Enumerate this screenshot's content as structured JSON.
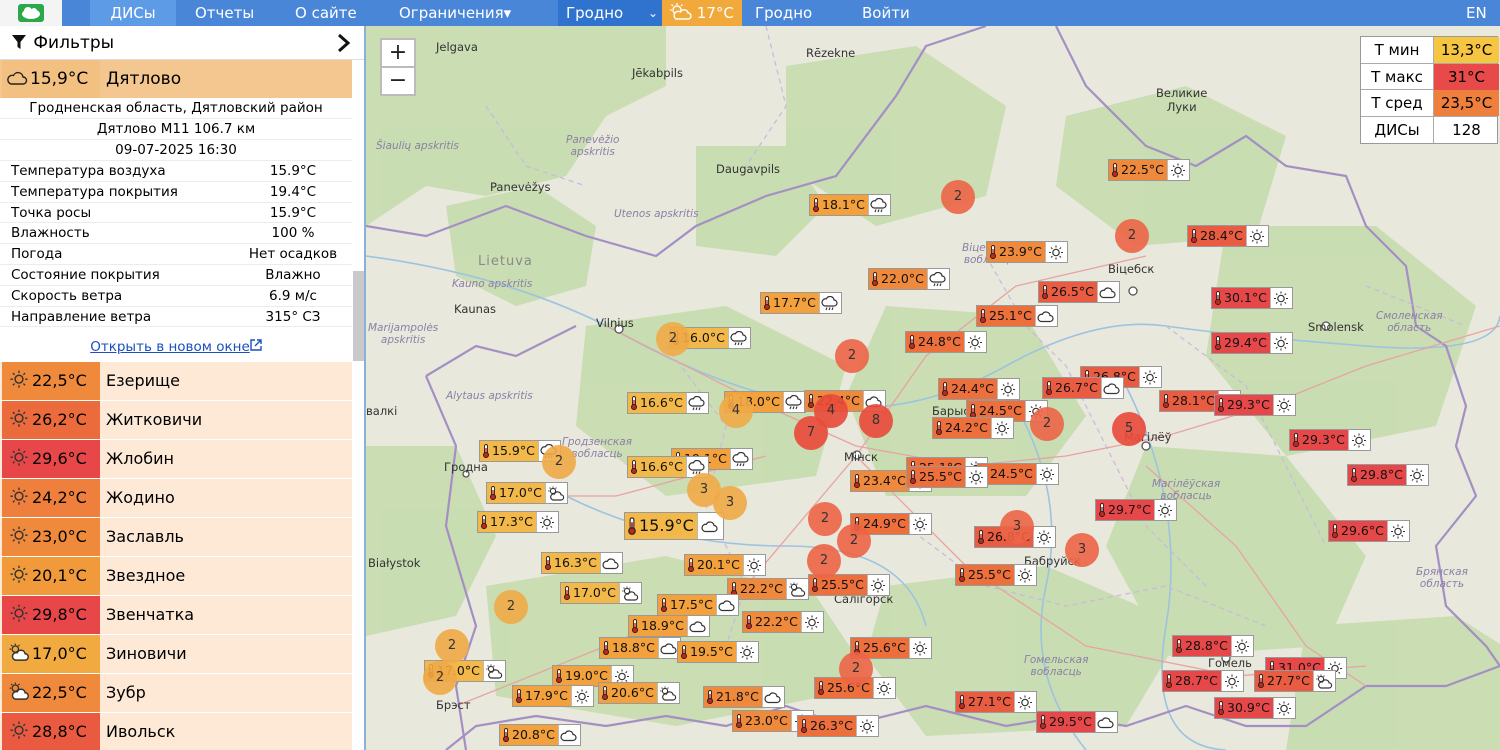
{
  "colors": {
    "topbar": "#4a86d8",
    "orange": "#f0a848",
    "darkorange": "#ee7f3c",
    "red": "#e84a4a",
    "pale": "#fde9d6"
  },
  "nav": {
    "logo": "cloud-logo-icon",
    "dis": "ДИСы",
    "reports": "Отчеты",
    "about": "О сайте",
    "limits": "Ограничения▾",
    "region_select": "Гродно",
    "weather_temp": "17°C",
    "weather_city": "Гродно",
    "login": "Войти",
    "lang": "EN"
  },
  "panel": {
    "filters": "Фильтры",
    "selected": {
      "temp": "15,9°C",
      "name": "Дятлово",
      "region": "Гродненская область, Дятловский район",
      "road": "Дятлово М11 106.7 км",
      "datetime": "09-07-2025 16:30"
    },
    "details": [
      {
        "k": "Температура воздуха",
        "v": "15.9°C"
      },
      {
        "k": "Температура покрытия",
        "v": "19.4°C"
      },
      {
        "k": "Точка росы",
        "v": "15.9°C"
      },
      {
        "k": "Влажность",
        "v": "100 %"
      },
      {
        "k": "Погода",
        "v": "Нет осадков"
      },
      {
        "k": "Состояние покрытия",
        "v": "Влажно"
      },
      {
        "k": "Скорость ветра",
        "v": "6.9 м/с"
      },
      {
        "k": "Направление ветра",
        "v": "315° СЗ"
      }
    ],
    "open_link": "Открыть в новом окне",
    "stations": [
      {
        "temp": "22,5°C",
        "name": "Езерище",
        "icon": "sun",
        "color": "#ef8a3c"
      },
      {
        "temp": "26,2°C",
        "name": "Житковичи",
        "icon": "sun",
        "color": "#ec6b3c"
      },
      {
        "temp": "29,6°C",
        "name": "Жлобин",
        "icon": "sun",
        "color": "#e8474a"
      },
      {
        "temp": "24,2°C",
        "name": "Жодино",
        "icon": "sun",
        "color": "#ee7f3c"
      },
      {
        "temp": "23,0°C",
        "name": "Заславль",
        "icon": "sun",
        "color": "#ef8a3c"
      },
      {
        "temp": "20,1°C",
        "name": "Звездное",
        "icon": "sun",
        "color": "#f09a3c"
      },
      {
        "temp": "29,8°C",
        "name": "Звенчатка",
        "icon": "sun",
        "color": "#e8474a"
      },
      {
        "temp": "17,0°C",
        "name": "Зиновичи",
        "icon": "sun-cloud",
        "color": "#f0aa40"
      },
      {
        "temp": "22,5°C",
        "name": "Зубр",
        "icon": "sun-cloud",
        "color": "#ef8a3c"
      },
      {
        "temp": "28,8°C",
        "name": "Ивольск",
        "icon": "sun",
        "color": "#ea5a40"
      }
    ]
  },
  "stats": [
    {
      "k": "Т мин",
      "v": "13,3°C",
      "color": "#f6c542"
    },
    {
      "k": "Т макс",
      "v": "31°C",
      "color": "#e84a4a"
    },
    {
      "k": "Т сред",
      "v": "23,5°C",
      "color": "#ee7f3c"
    },
    {
      "k": "ДИСы",
      "v": "128",
      "color": "#ffffff"
    }
  ],
  "map_labels": [
    {
      "t": "Jelgava"
    },
    {
      "t": "Rēzekne"
    },
    {
      "t": "Jēkabpils"
    },
    {
      "t": "Великие\nЛуки"
    },
    {
      "t": "Šiaulių apskritis"
    },
    {
      "t": "Panevėžio\napskritis"
    },
    {
      "t": "Daugavpils"
    },
    {
      "t": "Panevėžys"
    },
    {
      "t": "Utenos apskritis"
    },
    {
      "t": "Lietuva"
    },
    {
      "t": "Kauno apskritis"
    },
    {
      "t": "Kaunas"
    },
    {
      "t": "Vilnius"
    },
    {
      "t": "Marijampolės\napskritis"
    },
    {
      "t": "Alytaus apskritis"
    },
    {
      "t": "Гродна"
    },
    {
      "t": "Białystok"
    },
    {
      "t": "Брэст"
    },
    {
      "t": "Віцебск"
    },
    {
      "t": "Smolensk"
    },
    {
      "t": "Смоленская\nобласть"
    },
    {
      "t": "Мінск"
    },
    {
      "t": "Магілёў"
    },
    {
      "t": "Магілёўская\nвобласць"
    },
    {
      "t": "Брянская\nобласть"
    },
    {
      "t": "Гомельская\nвобласць"
    },
    {
      "t": "Гомель"
    },
    {
      "t": "Салігорск"
    },
    {
      "t": "Барыс"
    },
    {
      "t": "Бабруйск"
    },
    {
      "t": "валкі"
    },
    {
      "t": "Віцебская\nвобласць"
    },
    {
      "t": "Гродзенская\nвобласць"
    }
  ],
  "markers": [
    {
      "t": "22.5°C",
      "w": "sun"
    },
    {
      "t": "18.1°C",
      "w": "rain"
    },
    {
      "t": "23.9°C",
      "w": "sun"
    },
    {
      "t": "28.4°C",
      "w": "sun"
    },
    {
      "t": "22.0°C",
      "w": "rain"
    },
    {
      "t": "26.5°C",
      "w": "cloud"
    },
    {
      "t": "30.1°C",
      "w": "sun"
    },
    {
      "t": "17.7°C",
      "w": "rain"
    },
    {
      "t": "25.1°C",
      "w": "cloud"
    },
    {
      "t": "16.0°C",
      "w": "rain"
    },
    {
      "t": "24.8°C",
      "w": "sun"
    },
    {
      "t": "29.4°C",
      "w": "sun"
    },
    {
      "t": "26.8°C",
      "w": "sun"
    },
    {
      "t": "24.4°C",
      "w": "sun"
    },
    {
      "t": "26.7°C",
      "w": "cloud"
    },
    {
      "t": "16.6°C",
      "w": "rain"
    },
    {
      "t": "18.0°C",
      "w": "rain"
    },
    {
      "t": "22.4°C",
      "w": "cloud"
    },
    {
      "t": "24.5°C",
      "w": "sun"
    },
    {
      "t": "28.1°C",
      "w": "sun"
    },
    {
      "t": "29.3°C",
      "w": "sun"
    },
    {
      "t": "24.2°C",
      "w": "sun"
    },
    {
      "t": "29.3°C",
      "w": "sun"
    },
    {
      "t": "15.9°C",
      "w": "rain"
    },
    {
      "t": "19.1°C",
      "w": "rain"
    },
    {
      "t": "16.6°C",
      "w": "rain"
    },
    {
      "t": "25.1°C",
      "w": "sun"
    },
    {
      "t": "24.5°C",
      "w": "sun"
    },
    {
      "t": "23.4°C",
      "w": "sun"
    },
    {
      "t": "25.5°C",
      "w": "sun"
    },
    {
      "t": "29.8°C",
      "w": "sun"
    },
    {
      "t": "17.0°C",
      "w": "sun-cloud"
    },
    {
      "t": "29.7°C",
      "w": "sun"
    },
    {
      "t": "17.3°C",
      "w": "sun"
    },
    {
      "t": "15.9°C",
      "w": "cloud"
    },
    {
      "t": "24.9°C",
      "w": "sun"
    },
    {
      "t": "29.6°C",
      "w": "sun"
    },
    {
      "t": "26.8°C",
      "w": "sun"
    },
    {
      "t": "16.3°C",
      "w": "cloud"
    },
    {
      "t": "20.1°C",
      "w": "sun"
    },
    {
      "t": "25.5°C",
      "w": "sun"
    },
    {
      "t": "17.0°C",
      "w": "sun-cloud"
    },
    {
      "t": "22.2°C",
      "w": "sun-cloud"
    },
    {
      "t": "25.5°C",
      "w": "sun"
    },
    {
      "t": "17.5°C",
      "w": "cloud"
    },
    {
      "t": "18.9°C",
      "w": "cloud"
    },
    {
      "t": "22.2°C",
      "w": "sun"
    },
    {
      "t": "18.8°C",
      "w": "cloud"
    },
    {
      "t": "19.5°C",
      "w": "sun"
    },
    {
      "t": "25.6°C",
      "w": "sun"
    },
    {
      "t": "28.8°C",
      "w": "sun"
    },
    {
      "t": "17.0°C",
      "w": "sun-cloud"
    },
    {
      "t": "19.0°C",
      "w": "sun"
    },
    {
      "t": "31.0°C",
      "w": "sun"
    },
    {
      "t": "28.7°C",
      "w": "sun"
    },
    {
      "t": "27.7°C",
      "w": "sun-cloud"
    },
    {
      "t": "17.9°C",
      "w": "sun"
    },
    {
      "t": "20.6°C",
      "w": "sun-cloud"
    },
    {
      "t": "21.8°C",
      "w": "cloud"
    },
    {
      "t": "25.6°C",
      "w": "sun"
    },
    {
      "t": "27.1°C",
      "w": "sun"
    },
    {
      "t": "30.9°C",
      "w": "sun"
    },
    {
      "t": "23.0°C",
      "w": "sun"
    },
    {
      "t": "26.3°C",
      "w": "sun"
    },
    {
      "t": "29.5°C",
      "w": "cloud"
    },
    {
      "t": "20.8°C",
      "w": "cloud"
    }
  ],
  "clusters": [
    "2",
    "2",
    "2",
    "2",
    "2",
    "2",
    "4",
    "4",
    "8",
    "7",
    "2",
    "5",
    "2",
    "3",
    "3",
    "2",
    "3",
    "3",
    "2",
    "2",
    "2",
    "2"
  ]
}
